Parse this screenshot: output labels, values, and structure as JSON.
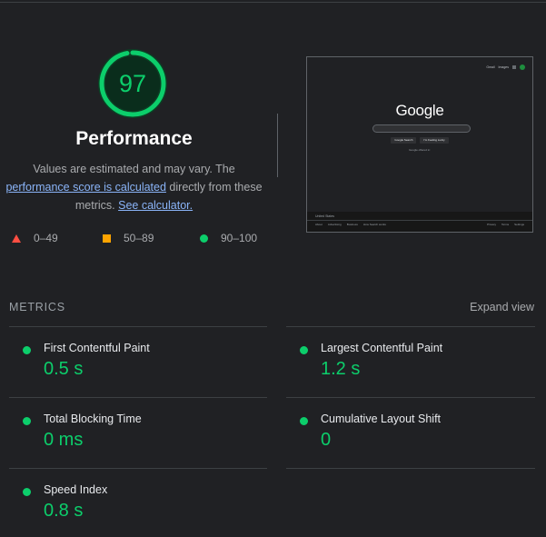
{
  "performance": {
    "score": "97",
    "score_value": 97,
    "title": "Performance",
    "desc_prefix": "Values are estimated and may vary. The",
    "score_link": "performance score is calculated",
    "desc_middle": "directly from these metrics.",
    "calculator_link": "See calculator."
  },
  "legend": [
    {
      "shape": "triangle",
      "range": "0–49",
      "color": "#ff4e42"
    },
    {
      "shape": "square",
      "range": "50–89",
      "color": "#ffa400"
    },
    {
      "shape": "circle",
      "range": "90–100",
      "color": "#0cce6b"
    }
  ],
  "screenshot": {
    "top_links": [
      "Gmail",
      "Images"
    ],
    "logo": "Google",
    "buttons": [
      "Google Search",
      "I'm Feeling Lucky"
    ],
    "offered_in": "Google offered in: ",
    "country": "United States",
    "footer_left": [
      "About",
      "Advertising",
      "Business",
      "How Search works"
    ],
    "footer_right": [
      "Privacy",
      "Terms",
      "Settings"
    ]
  },
  "metrics": {
    "title": "METRICS",
    "expand_label": "Expand view",
    "items": [
      {
        "label": "First Contentful Paint",
        "value": "0.5 s",
        "status": "good"
      },
      {
        "label": "Largest Contentful Paint",
        "value": "1.2 s",
        "status": "good"
      },
      {
        "label": "Total Blocking Time",
        "value": "0 ms",
        "status": "good"
      },
      {
        "label": "Cumulative Layout Shift",
        "value": "0",
        "status": "good"
      },
      {
        "label": "Speed Index",
        "value": "0.8 s",
        "status": "good"
      }
    ]
  },
  "colors": {
    "pass": "#0cce6b",
    "average": "#ffa400",
    "fail": "#ff4e42",
    "link": "#8ab4f8",
    "background": "#202124"
  }
}
